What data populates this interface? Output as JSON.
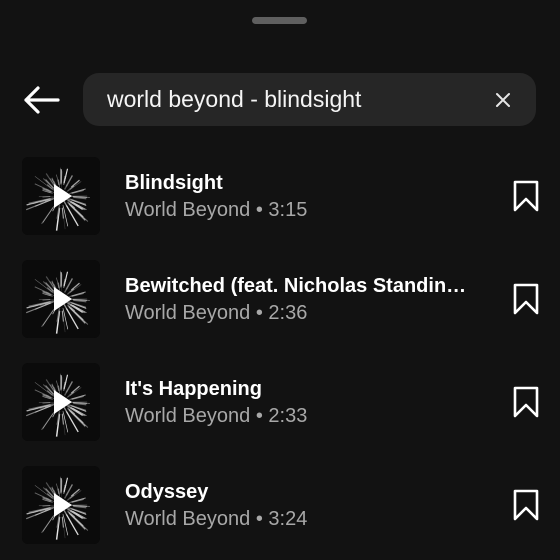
{
  "search": {
    "query": "world beyond - blindsight",
    "back_icon": "arrow-left-icon",
    "clear_icon": "close-icon"
  },
  "results": [
    {
      "title": "Blindsight",
      "artist": "World Beyond",
      "separator": "•",
      "duration": "3:15"
    },
    {
      "title": "Bewitched (feat. Nicholas Standing,…",
      "artist": "World Beyond",
      "separator": "•",
      "duration": "2:36"
    },
    {
      "title": "It's Happening",
      "artist": "World Beyond",
      "separator": "•",
      "duration": "2:33"
    },
    {
      "title": "Odyssey",
      "artist": "World Beyond",
      "separator": "•",
      "duration": "3:24"
    }
  ],
  "icons": {
    "bookmark": "bookmark-icon",
    "play": "play-icon"
  },
  "colors": {
    "background": "#121212",
    "search_field": "#262626",
    "title_text": "#ffffff",
    "secondary_text": "#a8a8a8"
  }
}
